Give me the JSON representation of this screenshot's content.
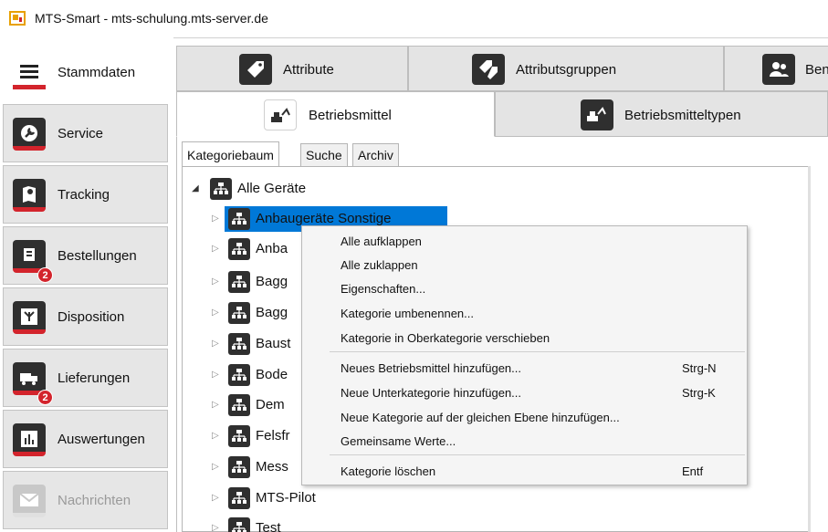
{
  "window": {
    "title": "MTS-Smart - mts-schulung.mts-server.de"
  },
  "sidebar": {
    "items": [
      {
        "label": "Stammdaten",
        "icon": "menu-list-icon",
        "active": true
      },
      {
        "label": "Service",
        "icon": "wrench-icon"
      },
      {
        "label": "Tracking",
        "icon": "map-pin-icon"
      },
      {
        "label": "Bestellungen",
        "icon": "cart-icon",
        "badge": "2"
      },
      {
        "label": "Disposition",
        "icon": "disposition-icon"
      },
      {
        "label": "Lieferungen",
        "icon": "truck-icon",
        "badge": "2"
      },
      {
        "label": "Auswertungen",
        "icon": "chart-icon"
      },
      {
        "label": "Nachrichten",
        "icon": "envelope-icon",
        "disabled": true
      }
    ]
  },
  "top_tabs": [
    {
      "label": "Attribute",
      "icon": "tag-icon"
    },
    {
      "label": "Attributsgruppen",
      "icon": "tags-icon"
    },
    {
      "label": "Ben",
      "icon": "users-icon"
    }
  ],
  "sub_tabs": [
    {
      "label": "Betriebsmittel",
      "icon": "excavator-icon",
      "active": true
    },
    {
      "label": "Betriebsmitteltypen",
      "icon": "excavator-type-icon"
    }
  ],
  "view_tabs": [
    {
      "label": "Kategoriebaum",
      "active": true
    },
    {
      "label": "Suche"
    },
    {
      "label": "Archiv"
    }
  ],
  "tree": {
    "root": "Alle Geräte",
    "children": [
      "Anbaugeräte Sonstige",
      "Anba",
      "Bagg",
      "Bagg",
      "Baust",
      "Bode",
      "Dem",
      "Felsfr",
      "Mess",
      "MTS-Pilot",
      "Test"
    ]
  },
  "context_menu": {
    "groups": [
      [
        {
          "label": "Alle aufklappen",
          "shortcut": ""
        },
        {
          "label": "Alle zuklappen",
          "shortcut": ""
        },
        {
          "label": "Eigenschaften...",
          "shortcut": ""
        },
        {
          "label": "Kategorie umbenennen...",
          "shortcut": ""
        },
        {
          "label": "Kategorie in Oberkategorie verschieben",
          "shortcut": ""
        }
      ],
      [
        {
          "label": "Neues Betriebsmittel hinzufügen...",
          "shortcut": "Strg-N"
        },
        {
          "label": "Neue Unterkategorie hinzufügen...",
          "shortcut": "Strg-K"
        },
        {
          "label": "Neue Kategorie auf der gleichen Ebene hinzufügen...",
          "shortcut": ""
        },
        {
          "label": "Gemeinsame Werte...",
          "shortcut": ""
        }
      ],
      [
        {
          "label": "Kategorie löschen",
          "shortcut": "Entf"
        }
      ]
    ]
  },
  "colors": {
    "accent_red": "#d3242c",
    "selection_blue": "#0078d7",
    "icon_dark": "#2f2f2f"
  }
}
